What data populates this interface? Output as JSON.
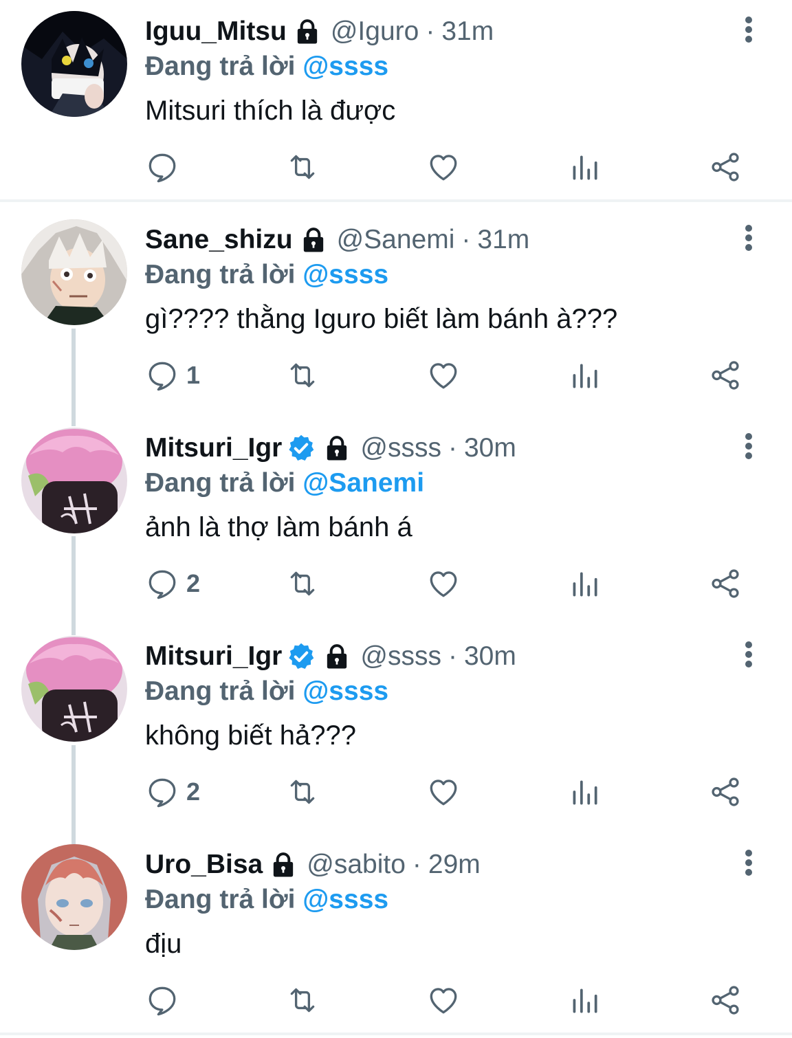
{
  "colors": {
    "text_primary": "#0f1419",
    "text_secondary": "#536471",
    "accent_blue": "#1d9bf0",
    "divider": "#eff3f4",
    "thread_line": "#cfd9de"
  },
  "tweets": [
    {
      "display_name": "Iguu_Mitsu",
      "verified": false,
      "protected": true,
      "handle": "@Iguro",
      "separator": "·",
      "time": "31m",
      "replying_prefix": "Đang trả lời",
      "replying_to": "@ssss",
      "text": "Mitsuri thích là được",
      "reply_count": "",
      "avatar": "iguro-avatar"
    },
    {
      "display_name": "Sane_shizu",
      "verified": false,
      "protected": true,
      "handle": "@Sanemi",
      "separator": "·",
      "time": "31m",
      "replying_prefix": "Đang trả lời",
      "replying_to": "@ssss",
      "text": "gì???? thằng Iguro biết làm bánh à???",
      "reply_count": "1",
      "avatar": "sanemi-avatar"
    },
    {
      "display_name": "Mitsuri_Igr",
      "verified": true,
      "protected": true,
      "handle": "@ssss",
      "separator": "·",
      "time": "30m",
      "replying_prefix": "Đang trả lời",
      "replying_to": "@Sanemi",
      "text": "ảnh là thợ làm bánh á",
      "reply_count": "2",
      "avatar": "mitsuri-avatar"
    },
    {
      "display_name": "Mitsuri_Igr",
      "verified": true,
      "protected": true,
      "handle": "@ssss",
      "separator": "·",
      "time": "30m",
      "replying_prefix": "Đang trả lời",
      "replying_to": "@ssss",
      "text": "không biết hả???",
      "reply_count": "2",
      "avatar": "mitsuri-avatar"
    },
    {
      "display_name": "Uro_Bisa",
      "verified": false,
      "protected": true,
      "handle": "@sabito",
      "separator": "·",
      "time": "29m",
      "replying_prefix": "Đang trả lời",
      "replying_to": "@ssss",
      "text": "địu",
      "reply_count": "",
      "avatar": "sabito-avatar"
    }
  ],
  "action_icons": [
    "reply-icon",
    "retweet-icon",
    "like-icon",
    "analytics-icon",
    "share-icon"
  ]
}
